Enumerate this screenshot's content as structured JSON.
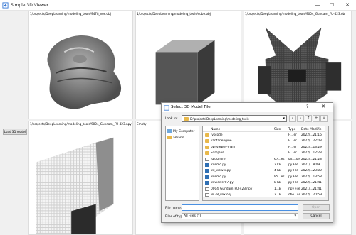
{
  "window": {
    "title": "Simple 3D Viewer",
    "minimize_glyph": "—",
    "maximize_glyph": "☐",
    "close_glyph": "✕"
  },
  "left_panel": {
    "load_button": "Load 3D model"
  },
  "viewports": [
    {
      "label": "1/projects/DeepLearning/modeling_tools/9478_vox.obj"
    },
    {
      "label": "1/projects/DeepLearning/modeling_tools/cube.obj"
    },
    {
      "label": "1/projects/DeepLearning/modeling_tools/9004_Gundam_FU-423.obj"
    },
    {
      "label": "1/projects/DeepLearning/modeling_tools/9004_Gundam_FU-423.npy"
    },
    {
      "label": "Empty"
    },
    {
      "label": ""
    }
  ],
  "dialog": {
    "title": "Select 3D Model File",
    "help_glyph": "?",
    "close_glyph": "✕",
    "look_in_label": "Look in:",
    "look_in_value": "D:\\projects\\DeepLearning\\modeling_tools",
    "sidebar": [
      "My Computer",
      "amano"
    ],
    "columns": {
      "name": "Name",
      "size": "Size",
      "type": "Type",
      "date": "Date Modifie"
    },
    "files": [
      {
        "name": ".vscode",
        "size": "",
        "type": "Fi...er",
        "date": "2022/...21:16",
        "kind": "folder"
      },
      {
        "name": "kantanengine",
        "size": "",
        "type": "Fi...er",
        "date": "2022/...22:03",
        "kind": "folder"
      },
      {
        "name": "obj-viewer-main",
        "size": "",
        "type": "Fi...er",
        "date": "2022/...13:29",
        "kind": "folder"
      },
      {
        "name": "Samples",
        "size": "",
        "type": "Fi...er",
        "date": "2022/...12:23",
        "kind": "folder"
      },
      {
        "name": ".gitignore",
        "size": "67...es",
        "type": "giti...ore",
        "date": "2022/...21:23",
        "kind": "file"
      },
      {
        "name": "2demo.py",
        "size": "2 KB",
        "type": "py File",
        "date": "2021/...8:09",
        "kind": "py"
      },
      {
        "name": "3d_viewer.py",
        "size": "4 KB",
        "type": "py File",
        "date": "2022/...23:00",
        "kind": "py"
      },
      {
        "name": "3demo.py",
        "size": "95...es",
        "type": "py File",
        "date": "2022/...13:58",
        "kind": "py"
      },
      {
        "name": "3dviewer07.py",
        "size": "8 KB",
        "type": "py File",
        "date": "2022/...21:41",
        "kind": "py"
      },
      {
        "name": "0004_Gundam_FU-423.npy",
        "size": "1...B",
        "type": "npy File",
        "date": "2021/...21:41",
        "kind": "file"
      },
      {
        "name": "9478_vox.obj",
        "size": "2...B",
        "type": "obe...ile",
        "date": "2022/...20:59",
        "kind": "file"
      }
    ],
    "file_name_label": "File name:",
    "file_name_value": "",
    "files_of_type_label": "Files of type:",
    "files_of_type_value": "All Files (*)",
    "open_button": "Open",
    "cancel_button": "Cancel"
  },
  "colors": {
    "accent": "#4a90e2",
    "folder": "#e8b84a",
    "python": "#2f6fb3"
  }
}
